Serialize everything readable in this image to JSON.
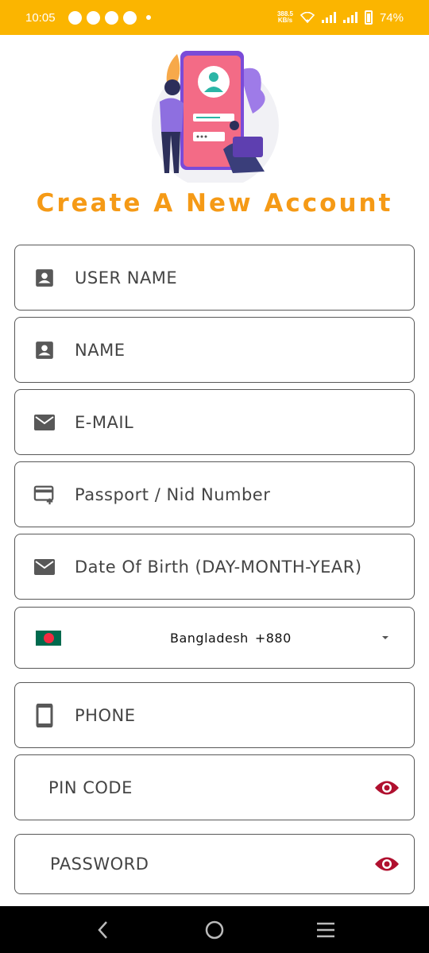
{
  "status_bar": {
    "time": "10:05",
    "net_speed_value": "388.5",
    "net_speed_unit": "KB/s",
    "battery": "74%"
  },
  "title": "Create A New Account",
  "fields": {
    "username": {
      "label": "USER NAME",
      "icon": "account-box-icon"
    },
    "name": {
      "label": "NAME",
      "icon": "account-box-icon"
    },
    "email": {
      "label": "E-MAIL",
      "icon": "mail-icon"
    },
    "passport": {
      "label": "Passport / Nid Number",
      "icon": "card-add-icon"
    },
    "dob": {
      "label": "Date Of Birth (DAY-MONTH-YEAR)",
      "icon": "mail-icon"
    },
    "country": {
      "name": "Bangladesh",
      "code": "+880"
    },
    "phone": {
      "label": "PHONE",
      "icon": "phone-icon"
    },
    "pin": {
      "label": "PIN CODE",
      "icon": "eye-icon"
    },
    "password": {
      "label": "PASSWORD",
      "icon": "eye-icon"
    }
  },
  "colors": {
    "status_bar": "#FBB500",
    "title": "#F59A16",
    "eye": "#B0102F",
    "nav_bar": "#000000"
  }
}
